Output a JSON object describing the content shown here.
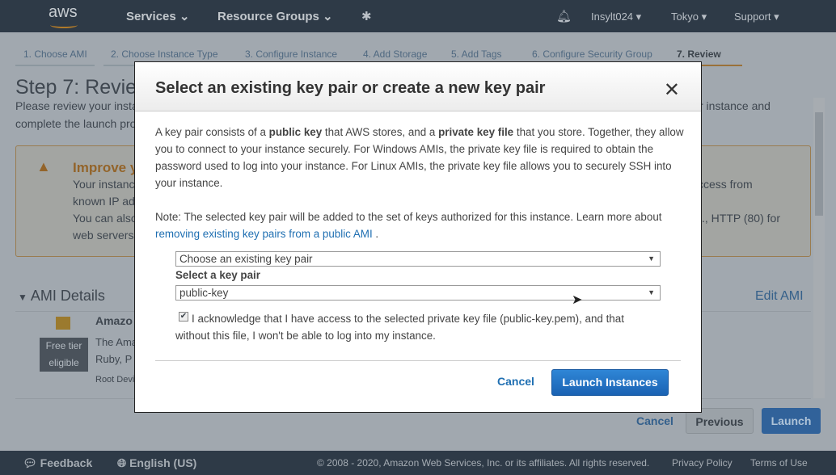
{
  "nav": {
    "logo": "aws",
    "services": "Services",
    "resource_groups": "Resource Groups",
    "user": "Insylt024",
    "region": "Tokyo",
    "support": "Support"
  },
  "steps": [
    "1. Choose AMI",
    "2. Choose Instance Type",
    "3. Configure Instance",
    "4. Add Storage",
    "5. Add Tags",
    "6. Configure Security Group",
    "7. Review"
  ],
  "page": {
    "title": "Step 7: Review",
    "intro1": "Please review your insta",
    "intro1_end": "r instance and",
    "intro2": "complete the launch pro",
    "warning_title": "Improve y",
    "warn1": "Your instanc",
    "warn1_end": "ccess from",
    "warn2": "known IP ad",
    "warn3": "You can also",
    "warn3_end": "., HTTP (80) for",
    "warn4": "web servers",
    "ami_section": "AMI Details",
    "edit_ami": "Edit AMI",
    "ami_name": "Amazo",
    "ami_desc1": "The Ama",
    "ami_desc2": "Ruby, P",
    "root_device": "Root Devi",
    "free_tier": "Free tier eligible",
    "cancel": "Cancel",
    "previous": "Previous",
    "launch": "Launch"
  },
  "modal": {
    "title": "Select an existing key pair or create a new key pair",
    "p1a": "A key pair consists of a ",
    "p1b": "public key",
    "p1c": " that AWS stores, and a ",
    "p1d": "private key file",
    "p1e": " that you store. Together, they allow you to connect to your instance securely. For Windows AMIs, the private key file is required to obtain the password used to log into your instance. For Linux AMIs, the private key file allows you to securely SSH into your instance.",
    "note": "Note:  The selected key pair will be added to the set of keys authorized for this instance. Learn more about ",
    "note_link": "removing existing key pairs from a public AMI",
    "note_end": " .",
    "mode_select": "Choose an existing key pair",
    "key_label": "Select a key pair",
    "key_select": "public-key",
    "ack": "I acknowledge that I have access to the selected private key file (public-key.pem), and that without this file, I won't be able to log into my instance.",
    "ack_checked": true,
    "cancel": "Cancel",
    "launch": "Launch Instances"
  },
  "footer": {
    "feedback": "Feedback",
    "language": "English (US)",
    "copyright": "© 2008 - 2020, Amazon Web Services, Inc. or its affiliates. All rights reserved.",
    "privacy": "Privacy Policy",
    "terms": "Terms of Use"
  }
}
